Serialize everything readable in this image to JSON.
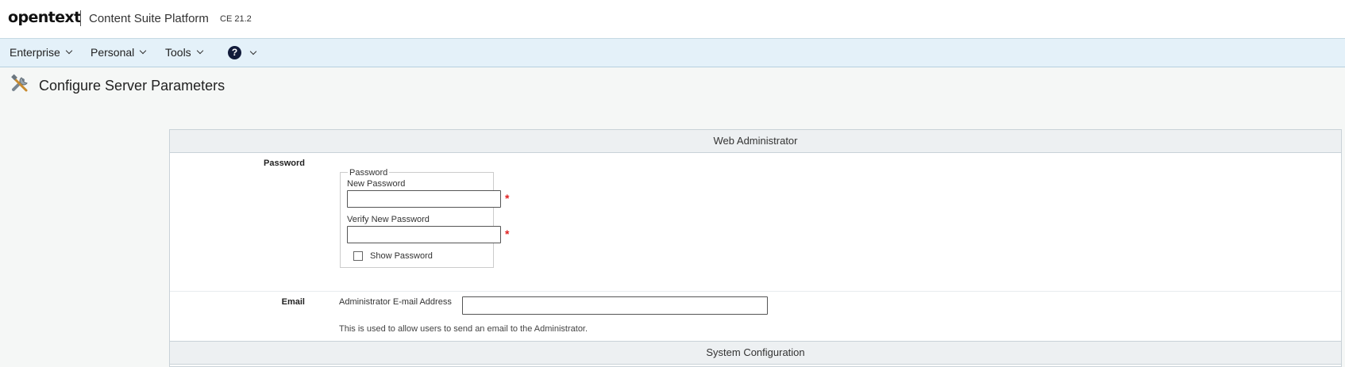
{
  "header": {
    "logo": "opentext",
    "product": "Content Suite Platform",
    "version": "CE 21.2"
  },
  "nav": {
    "items": [
      {
        "label": "Enterprise"
      },
      {
        "label": "Personal"
      },
      {
        "label": "Tools"
      }
    ],
    "help_glyph": "?"
  },
  "page": {
    "icon": "tools-icon",
    "title": "Configure Server Parameters"
  },
  "web_admin": {
    "header": "Web Administrator",
    "password": {
      "row_label": "Password",
      "fieldset_legend": "Password",
      "new_label": "New Password",
      "new_value": "",
      "verify_label": "Verify New Password",
      "verify_value": "",
      "required_mark": "*",
      "show_password_label": "Show Password",
      "show_password_checked": false
    },
    "email": {
      "row_label": "Email",
      "field_label": "Administrator E-mail Address",
      "value": "",
      "help": "This is used to allow users to send an email to the Administrator."
    }
  },
  "system_config": {
    "header": "System Configuration"
  },
  "colors": {
    "nav_bg": "#e4f1f9",
    "required": "#e02020",
    "help_icon_bg": "#111b3a"
  }
}
